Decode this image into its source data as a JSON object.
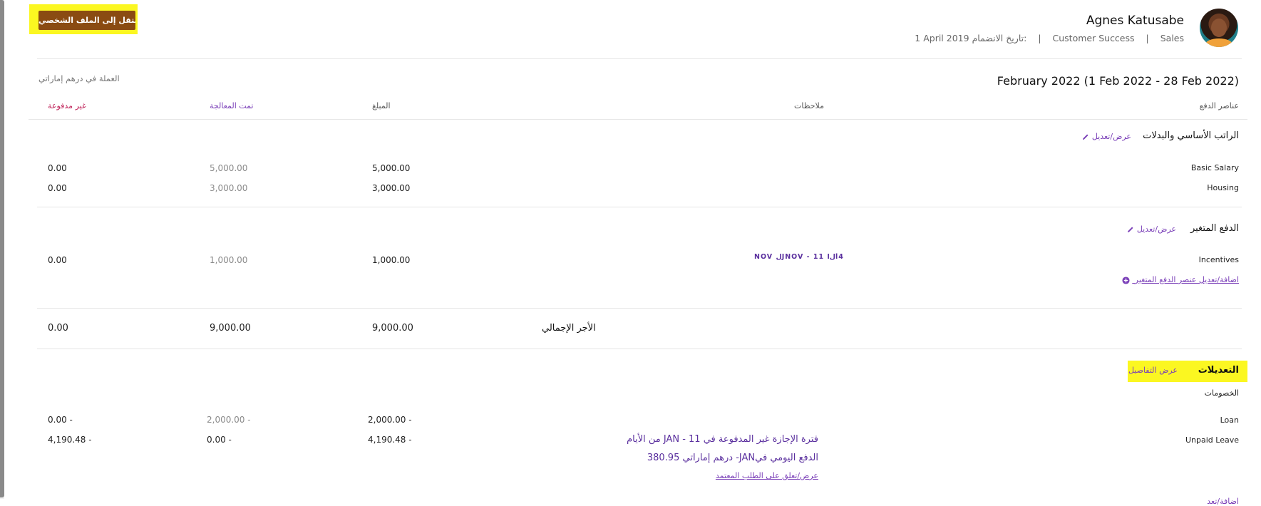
{
  "header": {
    "profile_button_label": "انتقل إلى الملف الشخصي",
    "employee_name": "Agnes Katusabe",
    "department": "Sales",
    "team": "Customer Success",
    "join_label": "تاريخ الانضمام:",
    "join_date": "1 April 2019"
  },
  "payroll": {
    "currency_note": "العملة في درهم إماراتي",
    "period_title": "February 2022 (1 Feb 2022 - 28 Feb 2022)",
    "columns": {
      "items": "عناصر الدفع",
      "notes": "ملاحظات",
      "amount": "المبلغ",
      "processed": "تمت المعالجة",
      "unpaid": "غير مدفوعة"
    }
  },
  "basic_section": {
    "title": "الراتب الأساسي والبدلات",
    "edit_label": "عرض/تعديل",
    "rows": [
      {
        "label": "Basic Salary",
        "amount": "5,000.00",
        "processed": "5,000.00",
        "unpaid": "0.00"
      },
      {
        "label": "Housing",
        "amount": "3,000.00",
        "processed": "3,000.00",
        "unpaid": "0.00"
      }
    ]
  },
  "variable_section": {
    "title": "الدفع المتغير",
    "edit_label": "عرض/تعديل",
    "rows": [
      {
        "label": "Incentives",
        "note": "NOV ﻝJNOV - 11 ﻝاl4",
        "amount": "1,000.00",
        "processed": "1,000.00",
        "unpaid": "0.00"
      }
    ],
    "add_label": "اضافة/تعديل عنصر الدفع المتغير"
  },
  "gross": {
    "label": "الأجر الإجمالي",
    "amount": "9,000.00",
    "processed": "9,000.00",
    "unpaid": "0.00"
  },
  "adjustments": {
    "title": "التعديلات",
    "details_label": "عرض التفاصيل",
    "deductions_label": "الخصومات",
    "rows": [
      {
        "label": "Loan",
        "amount": "2,000.00 -",
        "processed": "2,000.00 -",
        "unpaid": "0.00 -"
      },
      {
        "label": "Unpaid Leave",
        "amount": "4,190.48 -",
        "processed": "0.00 -",
        "unpaid": "4,190.48 -"
      }
    ],
    "leave_note_1": "فترة الإجازة غير المدفوعة في JAN - 11 من الأيام",
    "leave_note_2": "الدفع اليومي فيJAN- درهم إماراتي 380.95",
    "leave_link": "عرض/تعلق على الطلب المعتمد",
    "cut_off_link": "اضافة/تعد"
  },
  "colors": {
    "accent_purple": "#7a3fb8",
    "unpaid_pink": "#c0245a",
    "highlight_yellow": "#fbf721",
    "button_brown": "#8a4b12"
  }
}
